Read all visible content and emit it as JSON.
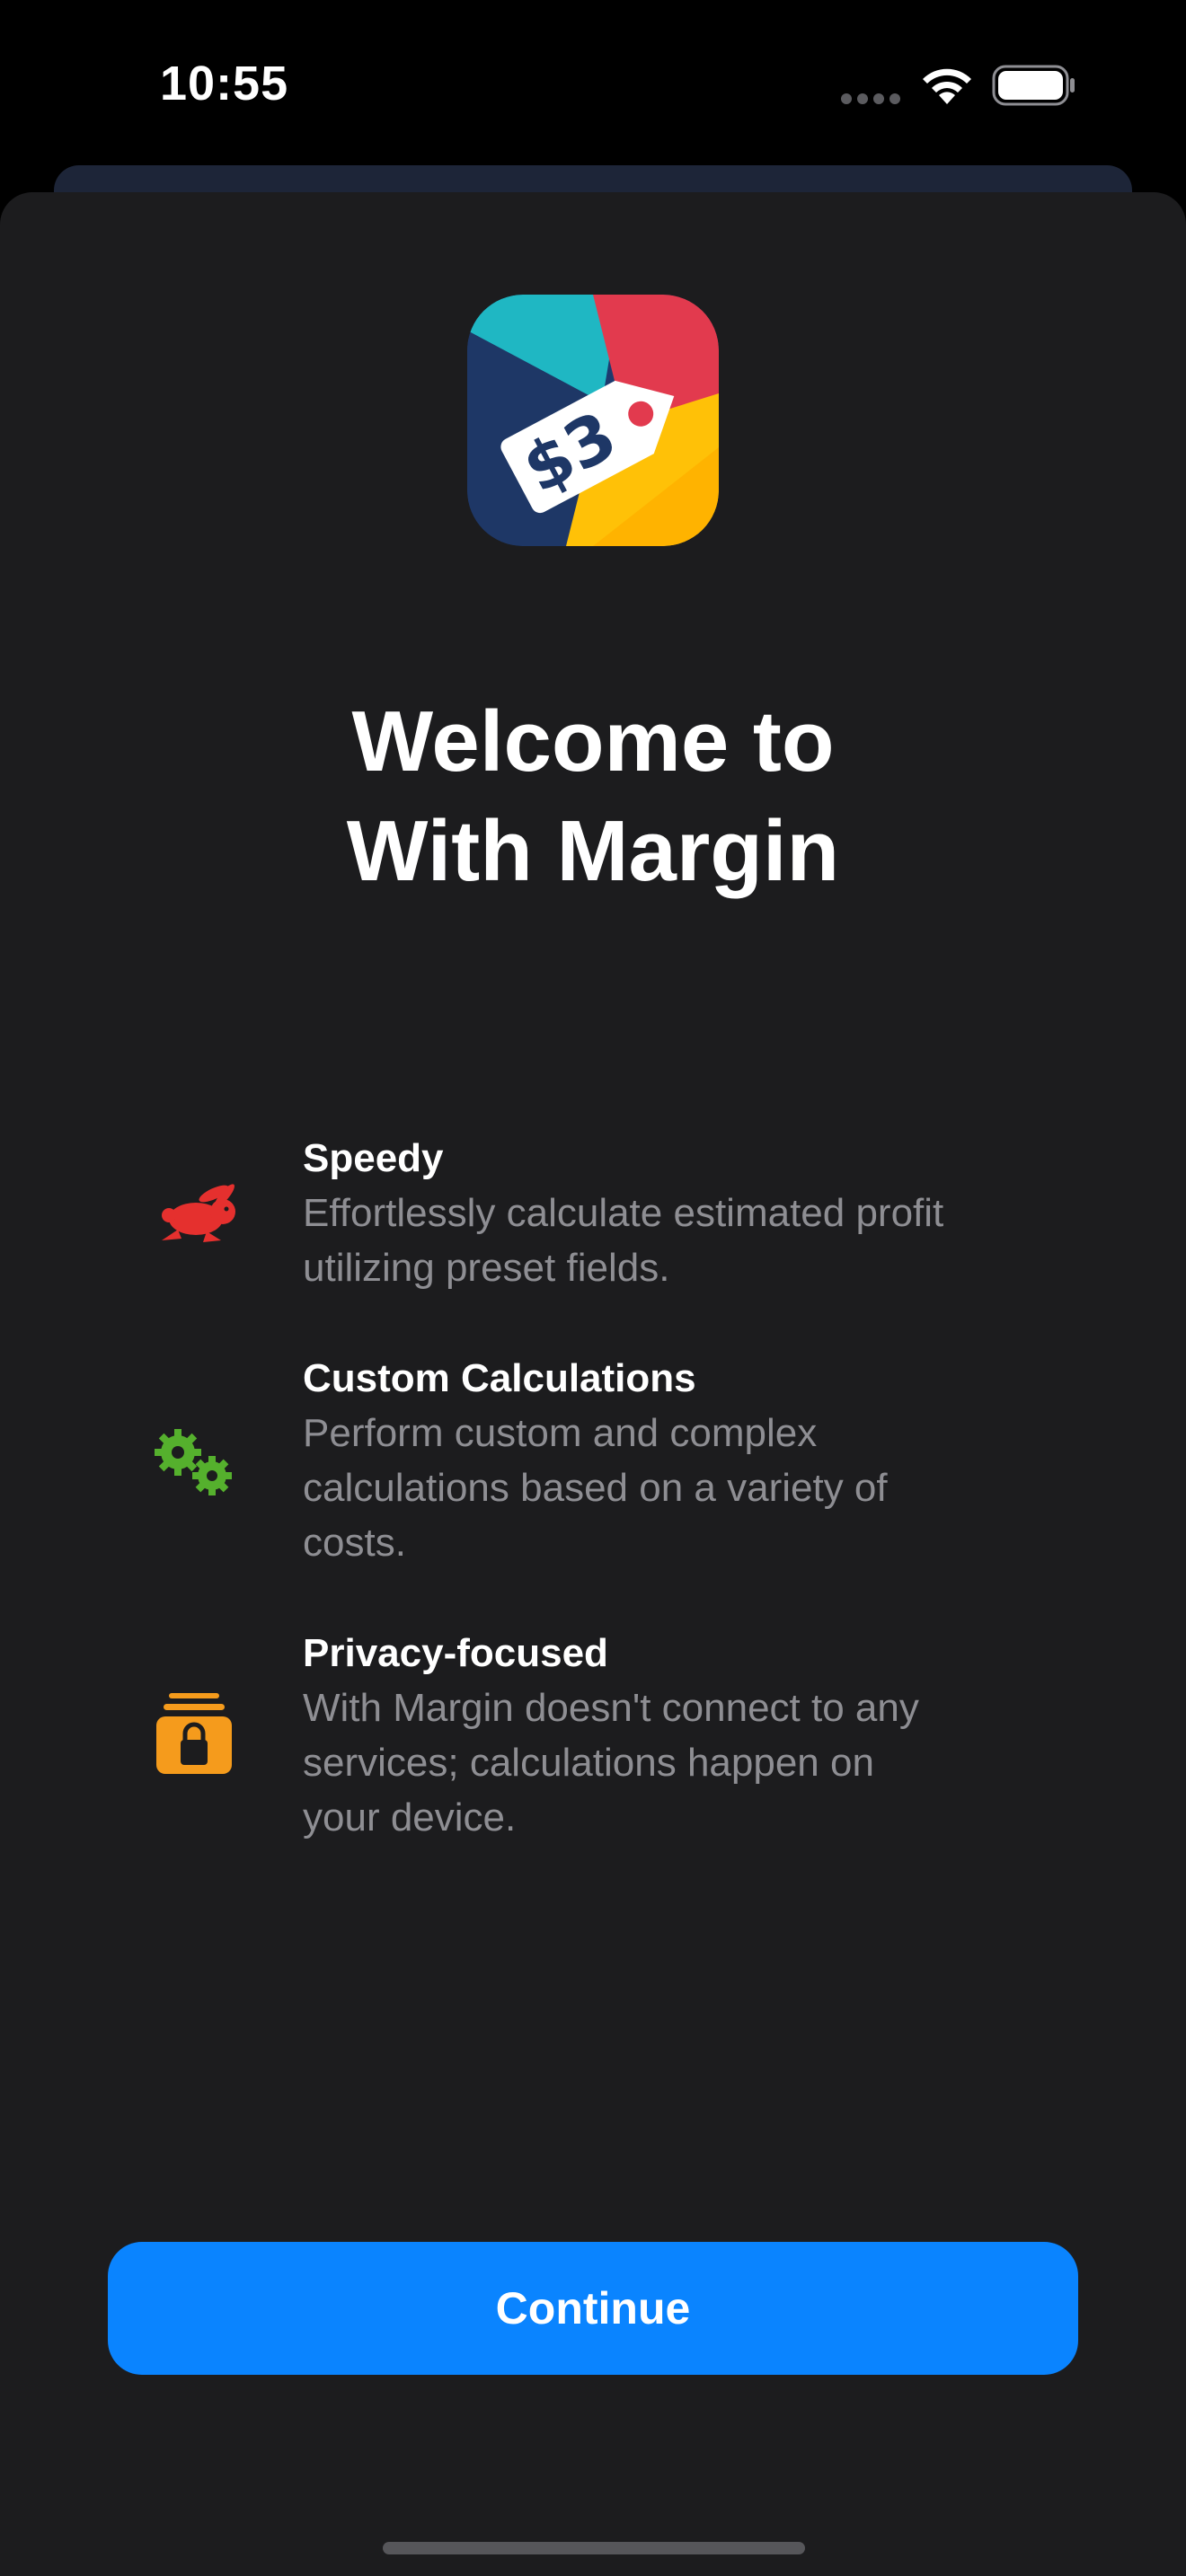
{
  "status_bar": {
    "time": "10:55",
    "icons": [
      "cellular-signal-icon",
      "wifi-icon",
      "battery-icon"
    ]
  },
  "app": {
    "icon_name": "price-tag-app-icon",
    "icon_text": "$3"
  },
  "welcome": {
    "title_line1": "Welcome to",
    "title_line2": "With Margin"
  },
  "features": [
    {
      "icon": "rabbit-icon",
      "icon_color": "#e5302e",
      "title": "Speedy",
      "desc_lines": [
        "Effortlessly calculate estimated profit",
        "utilizing preset fields."
      ]
    },
    {
      "icon": "gears-icon",
      "icon_color": "#55b02d",
      "title": "Custom Calculations",
      "desc_lines": [
        "Perform custom and complex",
        "calculations based on a variety of",
        "costs."
      ]
    },
    {
      "icon": "lock-archive-icon",
      "icon_color": "#f59b1c",
      "title": "Privacy-focused",
      "desc_lines": [
        "With Margin doesn't connect to any",
        "services; calculations happen on",
        "your device."
      ]
    }
  ],
  "actions": {
    "continue_label": "Continue"
  },
  "colors": {
    "accent": "#0a84ff",
    "sheet_background": "#1c1c1e",
    "secondary_text": "#8e8e93"
  }
}
